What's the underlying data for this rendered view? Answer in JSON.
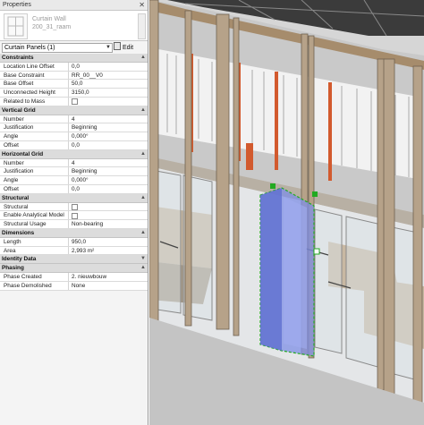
{
  "palette": {
    "title": "Properties",
    "close_glyph": "✕"
  },
  "type_selector": {
    "family": "Curtain Wall",
    "type": "200_31_raam"
  },
  "instance_filter": {
    "value": "Curtain Panels (1)",
    "edit_type_label": "Edit Type"
  },
  "groups": {
    "constraints": "Constraints",
    "vertical_grid": "Vertical Grid",
    "horizontal_grid": "Horizontal Grid",
    "structural": "Structural",
    "dimensions": "Dimensions",
    "identity_data": "Identity Data",
    "phasing": "Phasing"
  },
  "constraints": [
    {
      "label": "Location Line Offset",
      "value": "0,0"
    },
    {
      "label": "Base Constraint",
      "value": "RR_00__V0"
    },
    {
      "label": "Base Offset",
      "value": "50,0"
    },
    {
      "label": "Unconnected Height",
      "value": "3150,0"
    },
    {
      "label": "Related to Mass",
      "value": ""
    }
  ],
  "vertical_grid": [
    {
      "label": "Number",
      "value": "4"
    },
    {
      "label": "Justification",
      "value": "Beginning"
    },
    {
      "label": "Angle",
      "value": "0,000°"
    },
    {
      "label": "Offset",
      "value": "0,0"
    }
  ],
  "horizontal_grid": [
    {
      "label": "Number",
      "value": "4"
    },
    {
      "label": "Justification",
      "value": "Beginning"
    },
    {
      "label": "Angle",
      "value": "0,000°"
    },
    {
      "label": "Offset",
      "value": "0,0"
    }
  ],
  "structural": [
    {
      "label": "Structural",
      "value": ""
    },
    {
      "label": "Enable Analytical Model",
      "value": ""
    },
    {
      "label": "Structural Usage",
      "value": "Non-bearing"
    }
  ],
  "dimensions": [
    {
      "label": "Length",
      "value": "950,0"
    },
    {
      "label": "Area",
      "value": "2,993 m²"
    }
  ],
  "phasing": [
    {
      "label": "Phase Created",
      "value": "2. nieuwbouw"
    },
    {
      "label": "Phase Demolished",
      "value": "None"
    }
  ],
  "colors": {
    "selection_fill": "#7f8fe6",
    "selection_outline": "#22aa22",
    "timber": "#b6a289",
    "orange_stud": "#d25a2e"
  }
}
